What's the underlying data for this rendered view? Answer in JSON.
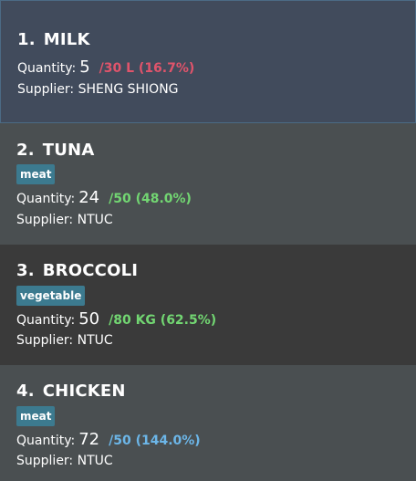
{
  "items": [
    {
      "index": "1.",
      "name": "MILK",
      "tag": "",
      "quantity_label": "Quantity:",
      "quantity": "5",
      "stat": "/30 L (16.7%)",
      "stat_color": "#e0546b",
      "supplier": "Supplier: SHENG SHIONG",
      "selected": true
    },
    {
      "index": "2.",
      "name": "TUNA",
      "tag": "meat",
      "quantity_label": "Quantity:",
      "quantity": "24",
      "stat": "/50 (48.0%)",
      "stat_color": "#72d672",
      "supplier": "Supplier: NTUC"
    },
    {
      "index": "3.",
      "name": "BROCCOLI",
      "tag": "vegetable",
      "quantity_label": "Quantity:",
      "quantity": "50",
      "stat": "/80 KG (62.5%)",
      "stat_color": "#72d672",
      "supplier": "Supplier: NTUC"
    },
    {
      "index": "4.",
      "name": "CHICKEN",
      "tag": "meat",
      "quantity_label": "Quantity:",
      "quantity": "72",
      "stat": "/50 (144.0%)",
      "stat_color": "#6cb6e8",
      "supplier": "Supplier: NTUC"
    }
  ],
  "colors": {
    "selected_bg": "#414b5c",
    "row_light": "#4a4f51",
    "row_dark": "#3a3a3a",
    "tag_bg": "#3c7a8f",
    "low_stock": "#e0546b",
    "ok_stock": "#72d672",
    "over_stock": "#6cb6e8"
  }
}
